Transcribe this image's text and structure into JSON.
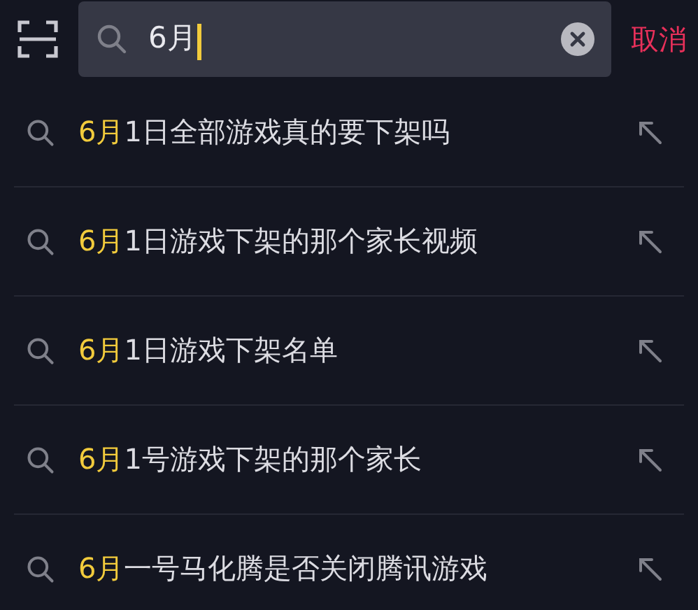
{
  "search": {
    "value": "6月",
    "cancel": "取消"
  },
  "suggestions": [
    {
      "match": "6月",
      "rest": "1日全部游戏真的要下架吗"
    },
    {
      "match": "6月",
      "rest": "1日游戏下架的那个家长视频"
    },
    {
      "match": "6月",
      "rest": "1日游戏下架名单"
    },
    {
      "match": "6月",
      "rest": "1号游戏下架的那个家长"
    },
    {
      "match": "6月",
      "rest": "一号马化腾是否关闭腾讯游戏"
    }
  ]
}
